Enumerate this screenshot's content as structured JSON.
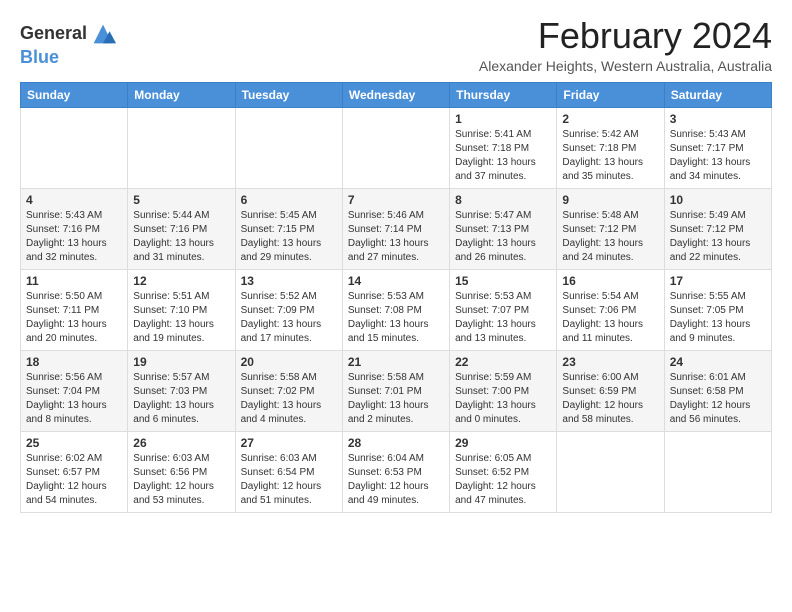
{
  "logo": {
    "general": "General",
    "blue": "Blue"
  },
  "header": {
    "month_title": "February 2024",
    "location": "Alexander Heights, Western Australia, Australia"
  },
  "weekdays": [
    "Sunday",
    "Monday",
    "Tuesday",
    "Wednesday",
    "Thursday",
    "Friday",
    "Saturday"
  ],
  "weeks": [
    [
      {
        "day": "",
        "info": ""
      },
      {
        "day": "",
        "info": ""
      },
      {
        "day": "",
        "info": ""
      },
      {
        "day": "",
        "info": ""
      },
      {
        "day": "1",
        "info": "Sunrise: 5:41 AM\nSunset: 7:18 PM\nDaylight: 13 hours and 37 minutes."
      },
      {
        "day": "2",
        "info": "Sunrise: 5:42 AM\nSunset: 7:18 PM\nDaylight: 13 hours and 35 minutes."
      },
      {
        "day": "3",
        "info": "Sunrise: 5:43 AM\nSunset: 7:17 PM\nDaylight: 13 hours and 34 minutes."
      }
    ],
    [
      {
        "day": "4",
        "info": "Sunrise: 5:43 AM\nSunset: 7:16 PM\nDaylight: 13 hours and 32 minutes."
      },
      {
        "day": "5",
        "info": "Sunrise: 5:44 AM\nSunset: 7:16 PM\nDaylight: 13 hours and 31 minutes."
      },
      {
        "day": "6",
        "info": "Sunrise: 5:45 AM\nSunset: 7:15 PM\nDaylight: 13 hours and 29 minutes."
      },
      {
        "day": "7",
        "info": "Sunrise: 5:46 AM\nSunset: 7:14 PM\nDaylight: 13 hours and 27 minutes."
      },
      {
        "day": "8",
        "info": "Sunrise: 5:47 AM\nSunset: 7:13 PM\nDaylight: 13 hours and 26 minutes."
      },
      {
        "day": "9",
        "info": "Sunrise: 5:48 AM\nSunset: 7:12 PM\nDaylight: 13 hours and 24 minutes."
      },
      {
        "day": "10",
        "info": "Sunrise: 5:49 AM\nSunset: 7:12 PM\nDaylight: 13 hours and 22 minutes."
      }
    ],
    [
      {
        "day": "11",
        "info": "Sunrise: 5:50 AM\nSunset: 7:11 PM\nDaylight: 13 hours and 20 minutes."
      },
      {
        "day": "12",
        "info": "Sunrise: 5:51 AM\nSunset: 7:10 PM\nDaylight: 13 hours and 19 minutes."
      },
      {
        "day": "13",
        "info": "Sunrise: 5:52 AM\nSunset: 7:09 PM\nDaylight: 13 hours and 17 minutes."
      },
      {
        "day": "14",
        "info": "Sunrise: 5:53 AM\nSunset: 7:08 PM\nDaylight: 13 hours and 15 minutes."
      },
      {
        "day": "15",
        "info": "Sunrise: 5:53 AM\nSunset: 7:07 PM\nDaylight: 13 hours and 13 minutes."
      },
      {
        "day": "16",
        "info": "Sunrise: 5:54 AM\nSunset: 7:06 PM\nDaylight: 13 hours and 11 minutes."
      },
      {
        "day": "17",
        "info": "Sunrise: 5:55 AM\nSunset: 7:05 PM\nDaylight: 13 hours and 9 minutes."
      }
    ],
    [
      {
        "day": "18",
        "info": "Sunrise: 5:56 AM\nSunset: 7:04 PM\nDaylight: 13 hours and 8 minutes."
      },
      {
        "day": "19",
        "info": "Sunrise: 5:57 AM\nSunset: 7:03 PM\nDaylight: 13 hours and 6 minutes."
      },
      {
        "day": "20",
        "info": "Sunrise: 5:58 AM\nSunset: 7:02 PM\nDaylight: 13 hours and 4 minutes."
      },
      {
        "day": "21",
        "info": "Sunrise: 5:58 AM\nSunset: 7:01 PM\nDaylight: 13 hours and 2 minutes."
      },
      {
        "day": "22",
        "info": "Sunrise: 5:59 AM\nSunset: 7:00 PM\nDaylight: 13 hours and 0 minutes."
      },
      {
        "day": "23",
        "info": "Sunrise: 6:00 AM\nSunset: 6:59 PM\nDaylight: 12 hours and 58 minutes."
      },
      {
        "day": "24",
        "info": "Sunrise: 6:01 AM\nSunset: 6:58 PM\nDaylight: 12 hours and 56 minutes."
      }
    ],
    [
      {
        "day": "25",
        "info": "Sunrise: 6:02 AM\nSunset: 6:57 PM\nDaylight: 12 hours and 54 minutes."
      },
      {
        "day": "26",
        "info": "Sunrise: 6:03 AM\nSunset: 6:56 PM\nDaylight: 12 hours and 53 minutes."
      },
      {
        "day": "27",
        "info": "Sunrise: 6:03 AM\nSunset: 6:54 PM\nDaylight: 12 hours and 51 minutes."
      },
      {
        "day": "28",
        "info": "Sunrise: 6:04 AM\nSunset: 6:53 PM\nDaylight: 12 hours and 49 minutes."
      },
      {
        "day": "29",
        "info": "Sunrise: 6:05 AM\nSunset: 6:52 PM\nDaylight: 12 hours and 47 minutes."
      },
      {
        "day": "",
        "info": ""
      },
      {
        "day": "",
        "info": ""
      }
    ]
  ]
}
